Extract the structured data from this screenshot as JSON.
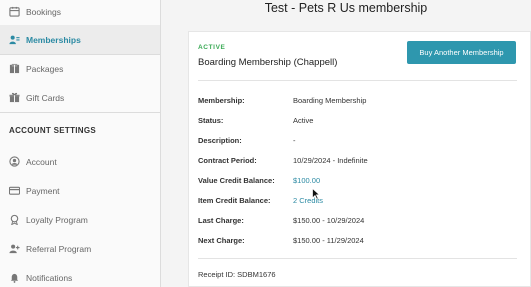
{
  "sidebar": {
    "items": [
      {
        "label": "Bookings",
        "icon": "calendar-icon"
      },
      {
        "label": "Memberships",
        "icon": "members-icon"
      },
      {
        "label": "Packages",
        "icon": "package-icon"
      },
      {
        "label": "Gift Cards",
        "icon": "gift-icon"
      }
    ],
    "section_title": "ACCOUNT SETTINGS",
    "settings_items": [
      {
        "label": "Account",
        "icon": "user-circle-icon"
      },
      {
        "label": "Payment",
        "icon": "credit-card-icon"
      },
      {
        "label": "Loyalty Program",
        "icon": "medal-icon"
      },
      {
        "label": "Referral Program",
        "icon": "add-user-icon"
      },
      {
        "label": "Notifications",
        "icon": "bell-icon"
      }
    ]
  },
  "page": {
    "title": "Test - Pets R Us membership"
  },
  "membership": {
    "status_badge": "ACTIVE",
    "name": "Boarding Membership (Chappell)",
    "buy_button": "Buy Another Membership",
    "details": [
      {
        "label": "Membership:",
        "value": "Boarding Membership"
      },
      {
        "label": "Status:",
        "value": "Active"
      },
      {
        "label": "Description:",
        "value": "-"
      },
      {
        "label": "Contract Period:",
        "value": "10/29/2024 - Indefinite"
      },
      {
        "label": "Value Credit Balance:",
        "value": "$100.00"
      },
      {
        "label": "Item Credit Balance:",
        "value": "2 Credits"
      },
      {
        "label": "Last Charge:",
        "value": "$150.00 - 10/29/2024"
      },
      {
        "label": "Next Charge:",
        "value": "$150.00 - 11/29/2024"
      }
    ],
    "receipt": "Receipt ID: SDBM1676"
  },
  "colors": {
    "accent": "#2e97ae",
    "active_badge": "#3aaa55",
    "link": "#2b8aa3"
  }
}
